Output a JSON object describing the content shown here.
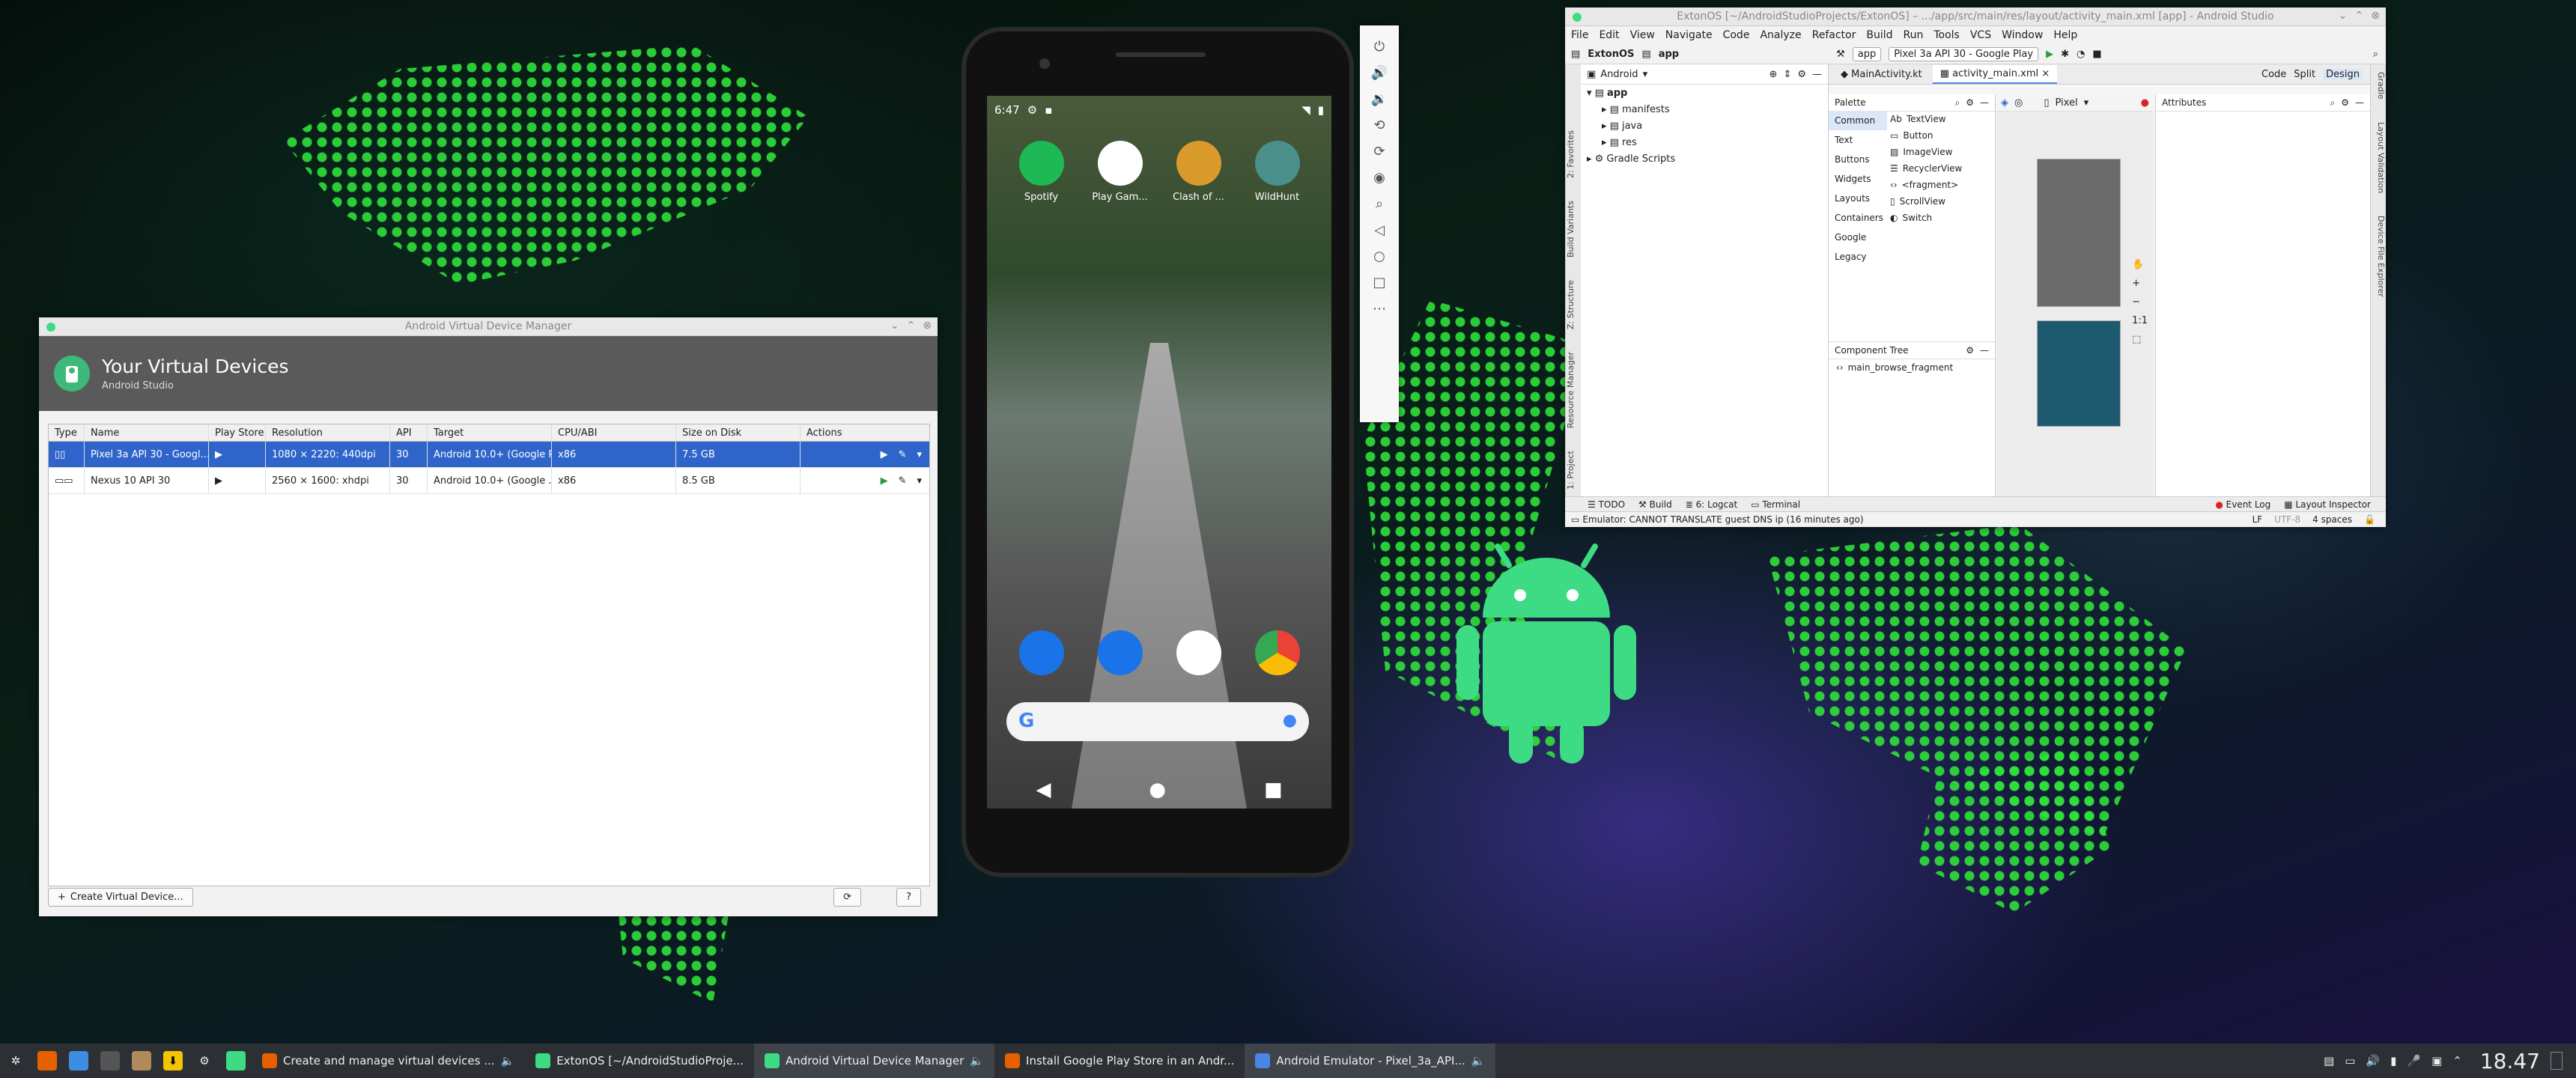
{
  "avd_manager": {
    "window_title": "Android Virtual Device Manager",
    "header_title": "Your Virtual Devices",
    "header_subtitle": "Android Studio",
    "columns": [
      "Type",
      "Name",
      "Play Store",
      "Resolution",
      "API",
      "Target",
      "CPU/ABI",
      "Size on Disk",
      "Actions"
    ],
    "rows": [
      {
        "name": "Pixel 3a API 30 - Googl...",
        "resolution": "1080 × 2220: 440dpi",
        "api": "30",
        "target": "Android 10.0+ (Google Play",
        "cpu": "x86",
        "size": "7.5 GB"
      },
      {
        "name": "Nexus 10 API 30",
        "resolution": "2560 × 1600: xhdpi",
        "api": "30",
        "target": "Android 10.0+ (Google ...",
        "cpu": "x86",
        "size": "8.5 GB"
      }
    ],
    "create_button": "Create Virtual Device...",
    "help_button": "?"
  },
  "phone": {
    "time": "6:47",
    "apps": [
      "Spotify",
      "Play Gam...",
      "Clash of ...",
      "WildHunt"
    ]
  },
  "android_studio": {
    "window_title": "ExtonOS [~/AndroidStudioProjects/ExtonOS] – .../app/src/main/res/layout/activity_main.xml [app] - Android Studio",
    "menu": [
      "File",
      "Edit",
      "View",
      "Navigate",
      "Code",
      "Analyze",
      "Refactor",
      "Build",
      "Run",
      "Tools",
      "VCS",
      "Window",
      "Help"
    ],
    "breadcrumb_project": "ExtonOS",
    "breadcrumb_module": "app",
    "run_config": "app",
    "device_combo": "Pixel 3a API 30 - Google Play",
    "project_view": "Android",
    "tree": {
      "root": "app",
      "children": [
        "manifests",
        "java",
        "res"
      ],
      "gradle": "Gradle Scripts"
    },
    "tabs": [
      "MainActivity.kt",
      "activity_main.xml"
    ],
    "modes": [
      "Code",
      "Split",
      "Design"
    ],
    "palette_title": "Palette",
    "palette_categories": [
      "Common",
      "Text",
      "Buttons",
      "Widgets",
      "Layouts",
      "Containers",
      "Google",
      "Legacy"
    ],
    "palette_items": [
      "TextView",
      "Button",
      "ImageView",
      "RecyclerView",
      "<fragment>",
      "ScrollView",
      "Switch"
    ],
    "component_tree_title": "Component Tree",
    "component_tree_item": "main_browse_fragment",
    "design_device": "Pixel",
    "attributes_title": "Attributes",
    "zoom_label": "1:1",
    "left_strips": [
      "1: Project",
      "Resource Manager",
      "Z: Structure",
      "Build Variants",
      "2: Favorites"
    ],
    "right_strips": [
      "Gradle",
      "Layout Validation",
      "Device File Explorer"
    ],
    "bottom_tabs": [
      "TODO",
      "Build",
      "6: Logcat",
      "Terminal"
    ],
    "bottom_right_tabs": [
      "Event Log",
      "Layout Inspector"
    ],
    "status_message": "Emulator: CANNOT TRANSLATE guest DNS ip (16 minutes ago)",
    "status_right": [
      "LF",
      "UTF-8",
      "4 spaces"
    ]
  },
  "taskbar": {
    "tasks": [
      {
        "label": "Create and manage virtual devices ..."
      },
      {
        "label": "ExtonOS [~/AndroidStudioProje..."
      },
      {
        "label": "Android Virtual Device Manager"
      },
      {
        "label": "Install Google Play Store in an Andr..."
      },
      {
        "label": "Android Emulator - Pixel_3a_API..."
      }
    ],
    "clock": "18.47"
  },
  "colors": {
    "selection": "#2f65ca",
    "android_green": "#3ddc84",
    "dots": "#2fe03a",
    "taskbar": "#2c2f33"
  }
}
